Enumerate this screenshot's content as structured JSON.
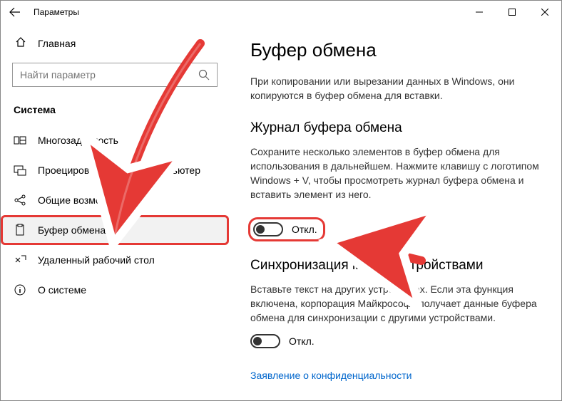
{
  "window": {
    "title": "Параметры"
  },
  "sidebar": {
    "home": "Главная",
    "search_placeholder": "Найти параметр",
    "section": "Система",
    "items": [
      {
        "label": "Многозадачность"
      },
      {
        "label": "Проецирование на этот компьютер"
      },
      {
        "label": "Общие возможности"
      },
      {
        "label": "Буфер обмена"
      },
      {
        "label": "Удаленный рабочий стол"
      },
      {
        "label": "О системе"
      }
    ]
  },
  "main": {
    "title": "Буфер обмена",
    "intro": "При копировании или вырезании данных в Windows, они копируются в буфер обмена для вставки.",
    "history": {
      "heading": "Журнал буфера обмена",
      "desc": "Сохраните несколько элементов в буфер обмена для использования в дальнейшем. Нажмите клавишу с логотипом Windows + V, чтобы просмотреть журнал буфера обмена и вставить элемент из него.",
      "toggle_label": "Откл."
    },
    "sync": {
      "heading": "Синхронизация между устройствами",
      "desc": "Вставьте текст на других устройствах. Если эта функция включена, корпорация Майкрософт получает данные буфера обмена для синхронизации с другими устройствами.",
      "toggle_label": "Откл."
    },
    "privacy_link": "Заявление о конфиденциальности"
  }
}
